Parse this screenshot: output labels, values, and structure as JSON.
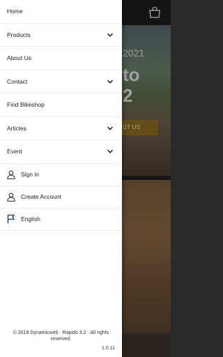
{
  "background": {
    "hero_year": "2021",
    "hero_line1": "to",
    "hero_line2": "2",
    "hero_button": "UT US"
  },
  "drawer": {
    "menu": [
      {
        "id": "home",
        "label": "Home",
        "has_submenu": false
      },
      {
        "id": "products",
        "label": "Products",
        "has_submenu": true
      },
      {
        "id": "about-us",
        "label": "About Us",
        "has_submenu": false
      },
      {
        "id": "contact",
        "label": "Contact",
        "has_submenu": true
      },
      {
        "id": "find-bikeshop",
        "label": "Find Bikeshop",
        "has_submenu": false
      },
      {
        "id": "articles",
        "label": "Articles",
        "has_submenu": true
      },
      {
        "id": "event",
        "label": "Event",
        "has_submenu": true
      }
    ],
    "account": [
      {
        "id": "sign-in",
        "label": "Sign in",
        "icon": "user-icon"
      },
      {
        "id": "create-account",
        "label": "Create Account",
        "icon": "user-icon"
      },
      {
        "id": "language",
        "label": "English",
        "icon": "flag-icon"
      }
    ],
    "footer": {
      "copyright": "© 2019 Dynamicweb · Rapido 3.2 · All rights reserved.",
      "version": "1.0.11"
    }
  },
  "colors": {
    "flag_icon": "#1f3a6b",
    "hero_button": "#8a6a1f"
  }
}
